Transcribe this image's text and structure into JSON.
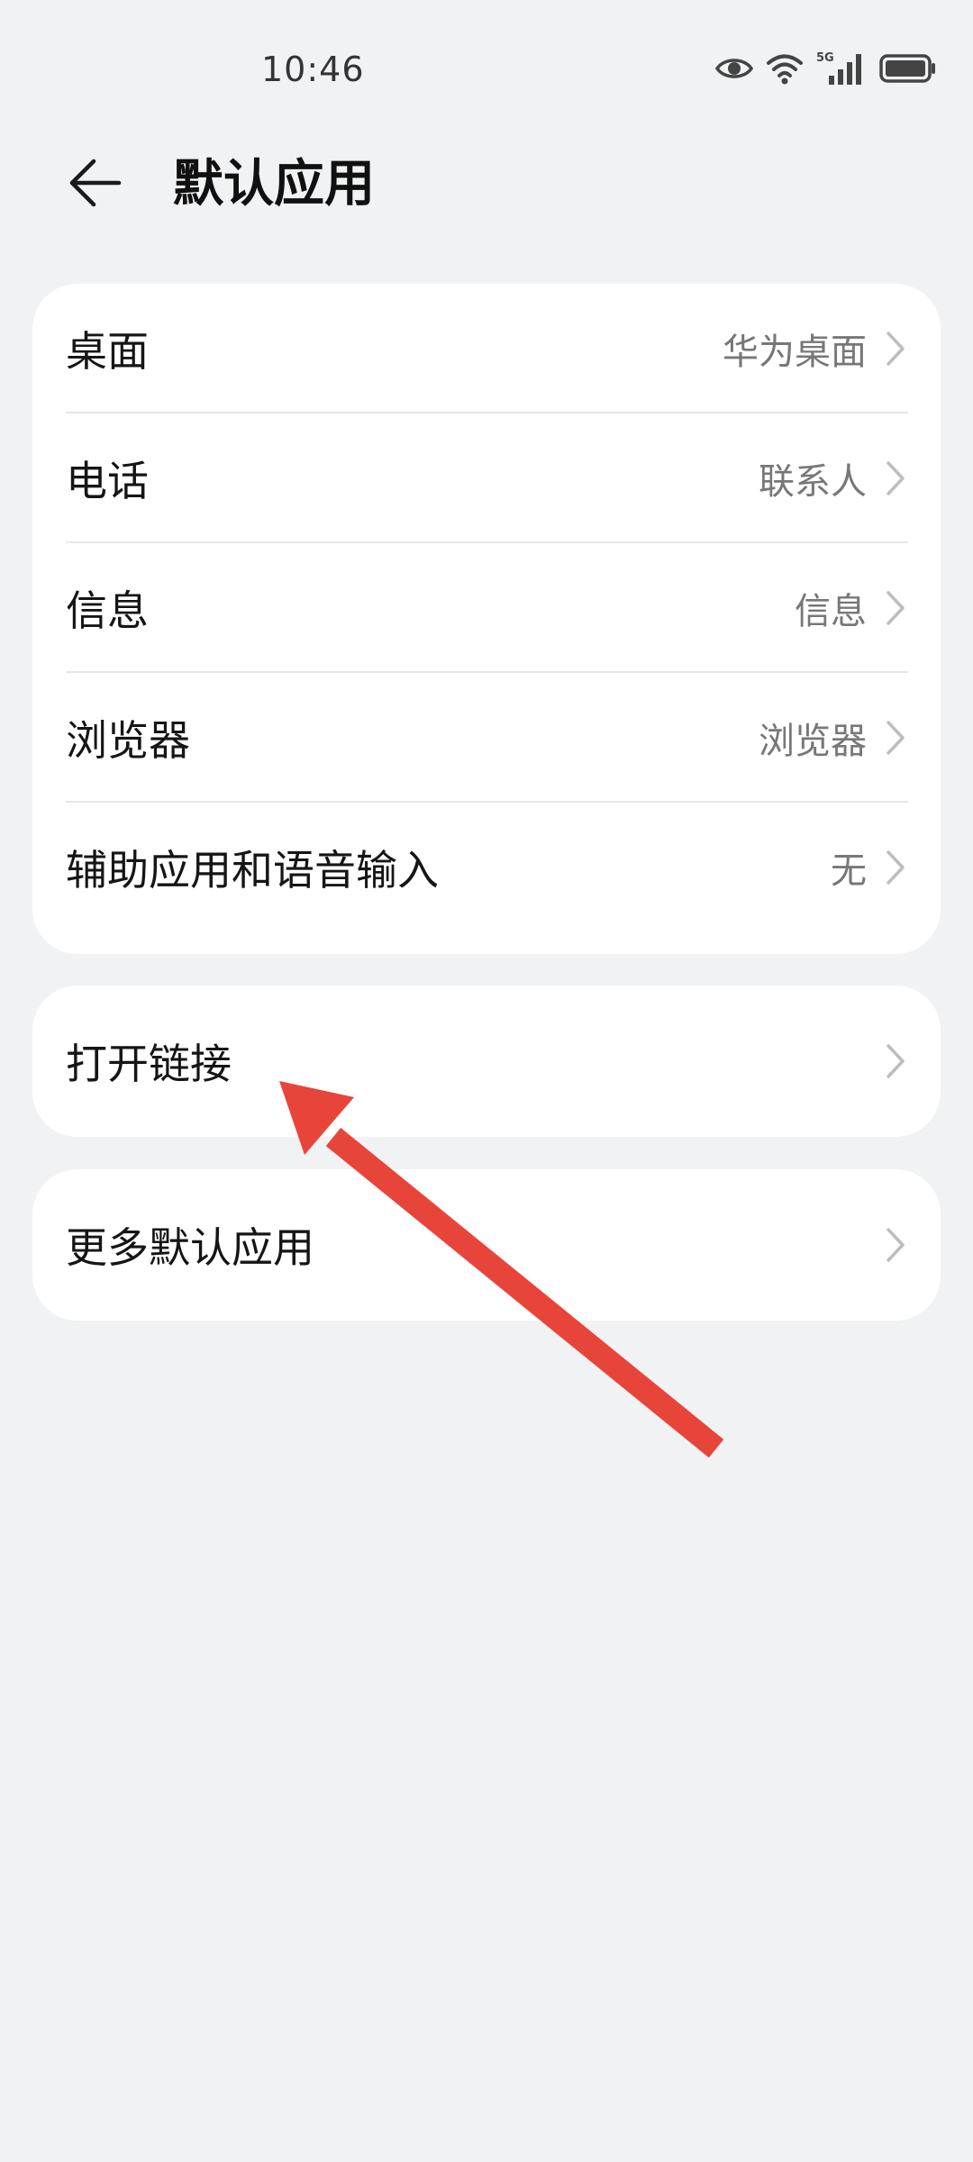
{
  "status_bar": {
    "time": "10:46",
    "icons": [
      "eye-icon",
      "wifi-icon",
      "5g-signal-icon",
      "battery-icon"
    ],
    "network_label": "5G"
  },
  "header": {
    "title": "默认应用",
    "back_icon": "back-arrow-icon"
  },
  "main_card": {
    "items": [
      {
        "label": "桌面",
        "value": "华为桌面"
      },
      {
        "label": "电话",
        "value": "联系人"
      },
      {
        "label": "信息",
        "value": "信息"
      },
      {
        "label": "浏览器",
        "value": "浏览器"
      },
      {
        "label": "辅助应用和语音输入",
        "value": "无"
      }
    ]
  },
  "links_card": {
    "label": "打开链接"
  },
  "more_card": {
    "label": "更多默认应用"
  },
  "colors": {
    "background": "#f1f2f4",
    "card": "#ffffff",
    "annotation_arrow": "#e8453a",
    "secondary_text": "#777777"
  }
}
